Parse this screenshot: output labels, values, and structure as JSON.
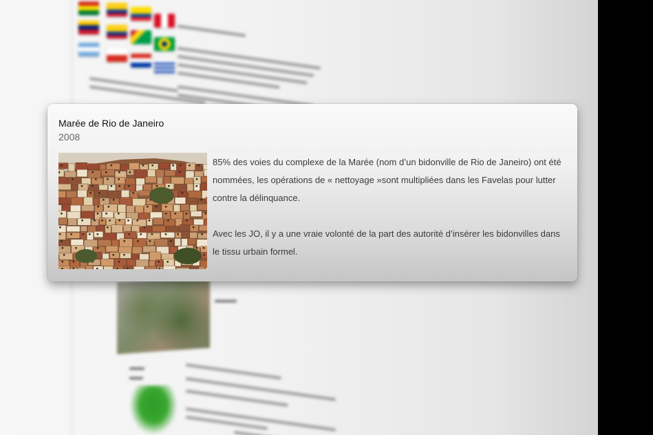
{
  "popup": {
    "title": "Marée de Rio de Janeiro",
    "year": "2008",
    "paragraphs": [
      "85% des voies du complexe de la Marée (nom d’un bidonville de Rio de Janeiro) ont été nommées, les opérations de « nettoyage »sont multipliées dans les Favelas pour lutter contre la délinquance.",
      "Avec les JO, il y a une vraie volonté de la part des autorité d’insérer les bidonvilles dans le tissu urbain formel."
    ],
    "image_icon": "favela-photo"
  },
  "background": {
    "flag_icons": [
      "bolivia-flag",
      "colombia-flag",
      "ecuador-flag",
      "peru-flag",
      "venezuela-flag",
      "colombia-flag",
      "guyana-flag",
      "brazil-flag",
      "argentina-flag",
      "chile-flag",
      "paraguay-flag",
      "uruguay-flag"
    ],
    "map_icon": "south-america-map"
  },
  "colors": {
    "right_bar": "#000000",
    "card_top": "#fafafa",
    "card_bottom": "#c5c5c5"
  }
}
